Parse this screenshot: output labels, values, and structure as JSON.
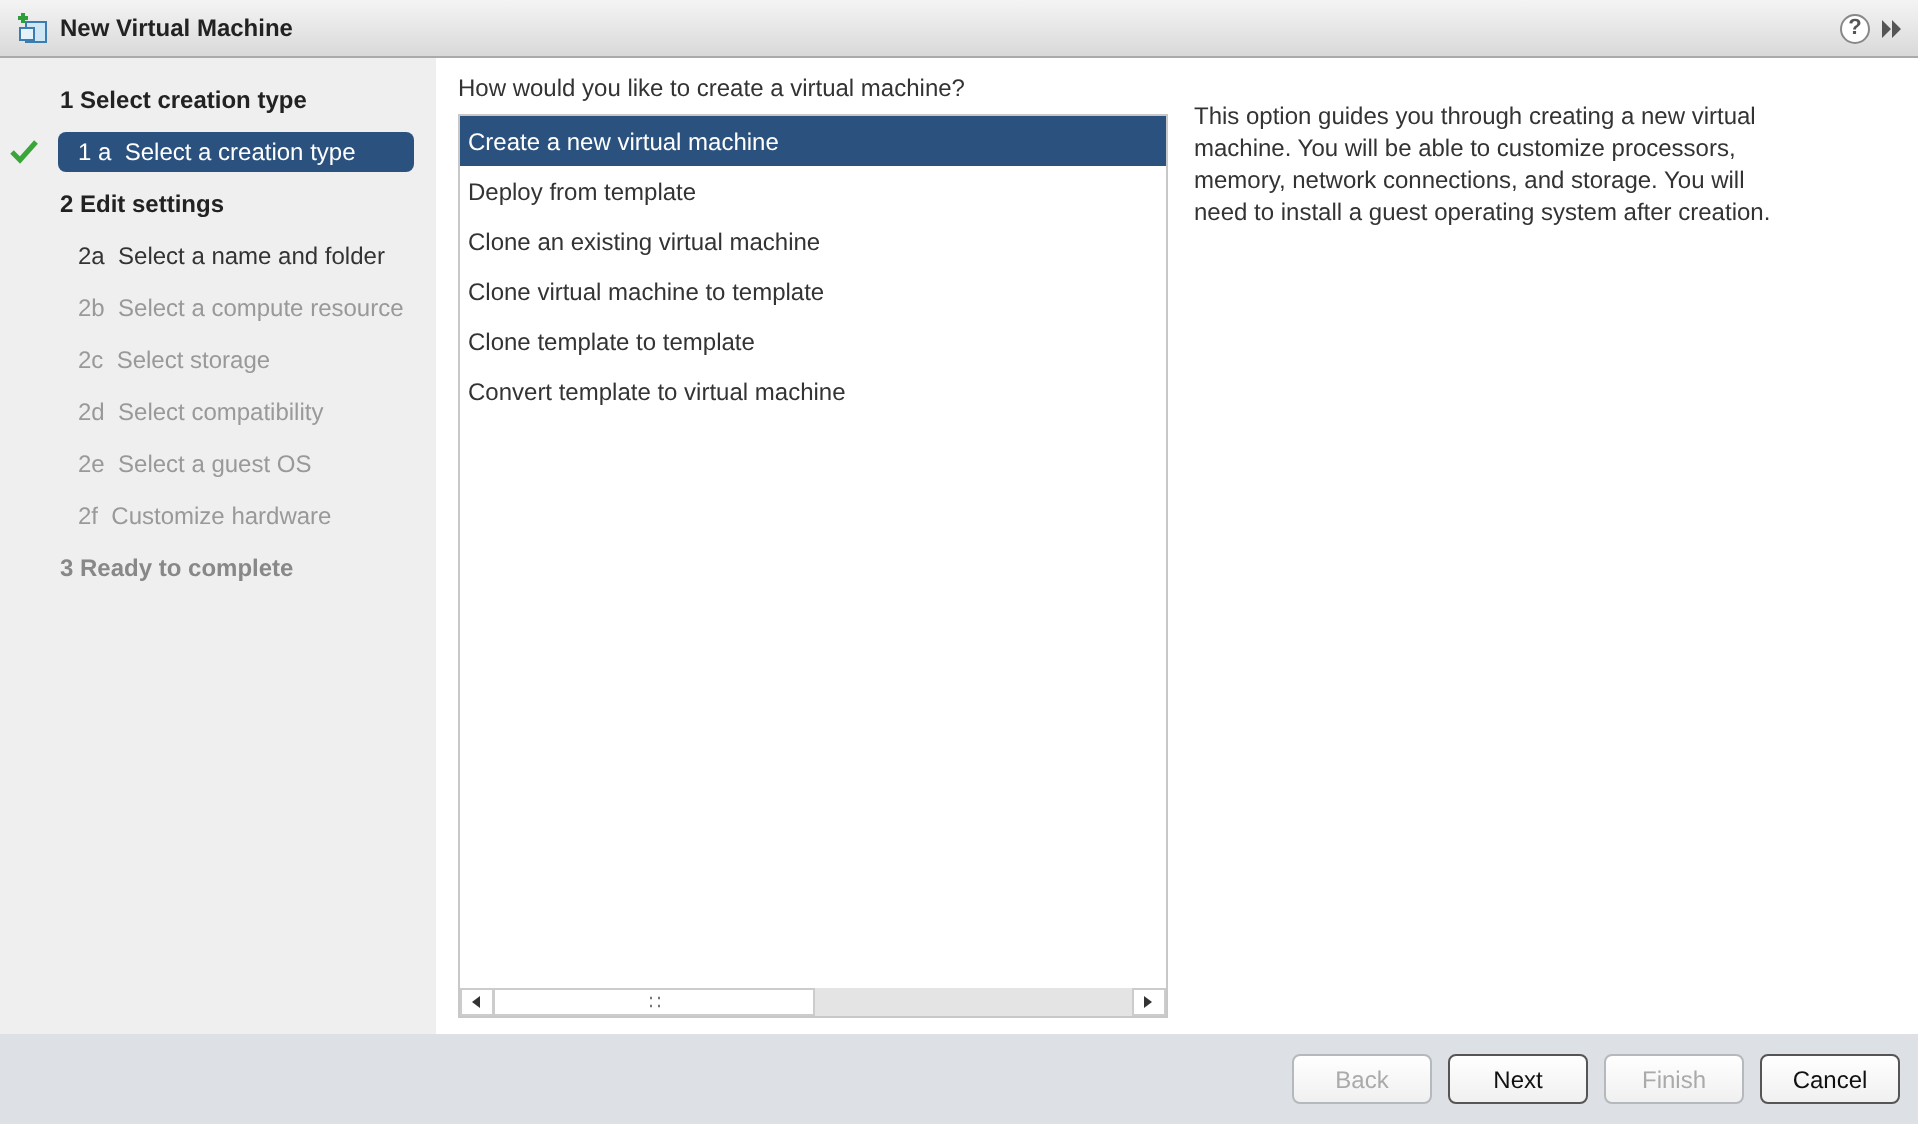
{
  "window": {
    "title": "New Virtual Machine",
    "help": "?"
  },
  "steps": [
    {
      "label": "1 Select creation type",
      "disabled": false,
      "children": [
        {
          "label": "1 a  Select a creation type",
          "selected": true,
          "done": true,
          "disabled": false
        }
      ]
    },
    {
      "label": "2 Edit settings",
      "disabled": false,
      "children": [
        {
          "label": "2a  Select a name and folder",
          "selected": false,
          "done": false,
          "disabled": false
        },
        {
          "label": "2b  Select a compute resource",
          "selected": false,
          "done": false,
          "disabled": true
        },
        {
          "label": "2c  Select storage",
          "selected": false,
          "done": false,
          "disabled": true
        },
        {
          "label": "2d  Select compatibility",
          "selected": false,
          "done": false,
          "disabled": true
        },
        {
          "label": "2e  Select a guest OS",
          "selected": false,
          "done": false,
          "disabled": true
        },
        {
          "label": "2f  Customize hardware",
          "selected": false,
          "done": false,
          "disabled": true
        }
      ]
    },
    {
      "label": "3 Ready to complete",
      "disabled": true
    }
  ],
  "question": "How would you like to create a virtual machine?",
  "options": [
    {
      "label": "Create a new virtual machine",
      "selected": true
    },
    {
      "label": "Deploy from template",
      "selected": false
    },
    {
      "label": "Clone an existing virtual machine",
      "selected": false
    },
    {
      "label": "Clone virtual machine to template",
      "selected": false
    },
    {
      "label": "Clone template to template",
      "selected": false
    },
    {
      "label": "Convert template to virtual machine",
      "selected": false
    }
  ],
  "description": "This option guides you through creating a new virtual machine. You will be able to customize processors, memory, network connections, and storage. You will need to install a guest operating system after creation.",
  "buttons": [
    {
      "label": "Back",
      "disabled": true
    },
    {
      "label": "Next",
      "disabled": false
    },
    {
      "label": "Finish",
      "disabled": true
    },
    {
      "label": "Cancel",
      "disabled": false
    }
  ]
}
